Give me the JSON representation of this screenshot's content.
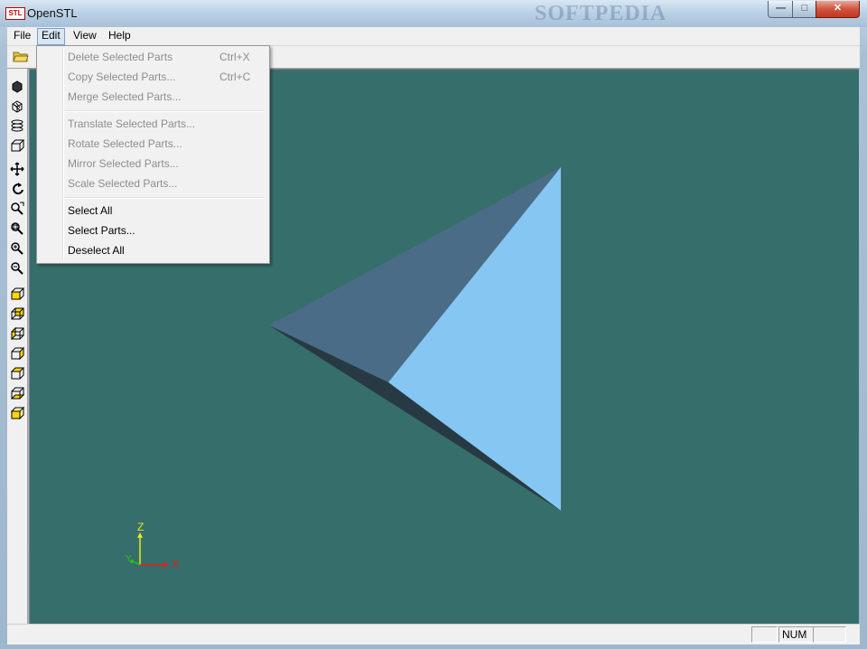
{
  "window": {
    "title": "OpenSTL",
    "icon_label": "STL",
    "watermark": "SOFTPEDIA",
    "controls": {
      "minimize": "—",
      "maximize": "□",
      "close": "✕"
    }
  },
  "menubar": {
    "items": [
      {
        "label": "File"
      },
      {
        "label": "Edit"
      },
      {
        "label": "View"
      },
      {
        "label": "Help"
      }
    ]
  },
  "edit_menu": {
    "groups": [
      [
        {
          "label": "Delete Selected Parts",
          "shortcut": "Ctrl+X",
          "enabled": false
        },
        {
          "label": "Copy Selected Parts...",
          "shortcut": "Ctrl+C",
          "enabled": false
        },
        {
          "label": "Merge Selected Parts...",
          "shortcut": "",
          "enabled": false
        }
      ],
      [
        {
          "label": "Translate Selected Parts...",
          "shortcut": "",
          "enabled": false
        },
        {
          "label": "Rotate Selected Parts...",
          "shortcut": "",
          "enabled": false
        },
        {
          "label": "Mirror Selected Parts...",
          "shortcut": "",
          "enabled": false
        },
        {
          "label": "Scale Selected Parts...",
          "shortcut": "",
          "enabled": false
        }
      ],
      [
        {
          "label": "Select All",
          "shortcut": "",
          "enabled": true
        },
        {
          "label": "Select Parts...",
          "shortcut": "",
          "enabled": true
        },
        {
          "label": "Deselect All",
          "shortcut": "",
          "enabled": true
        }
      ]
    ]
  },
  "toolbar": {
    "open_icon": "open-folder-icon"
  },
  "vtoolbar": {
    "icons": [
      "solid-view-icon",
      "wireframe-view-icon",
      "slice-view-icon",
      "box-view-icon",
      "pan-icon",
      "rotate-icon",
      "zoom-window-icon",
      "zoom-fit-icon",
      "zoom-in-icon",
      "zoom-out-icon",
      "view-front-icon",
      "view-back-icon",
      "view-left-icon",
      "view-right-icon",
      "view-top-icon",
      "view-bottom-icon",
      "view-iso-icon"
    ]
  },
  "viewport": {
    "background": "#366e6c",
    "face_light": "#86c6f2",
    "face_mid": "#4a6c86",
    "face_dark": "#273a44",
    "axes": {
      "x_label": "X",
      "y_label": "Y",
      "z_label": "Z",
      "x_color": "#e0201a",
      "y_color": "#22c21e",
      "z_color": "#e8e81a"
    }
  },
  "statusbar": {
    "cap": "",
    "num": "NUM",
    "scrl": ""
  }
}
